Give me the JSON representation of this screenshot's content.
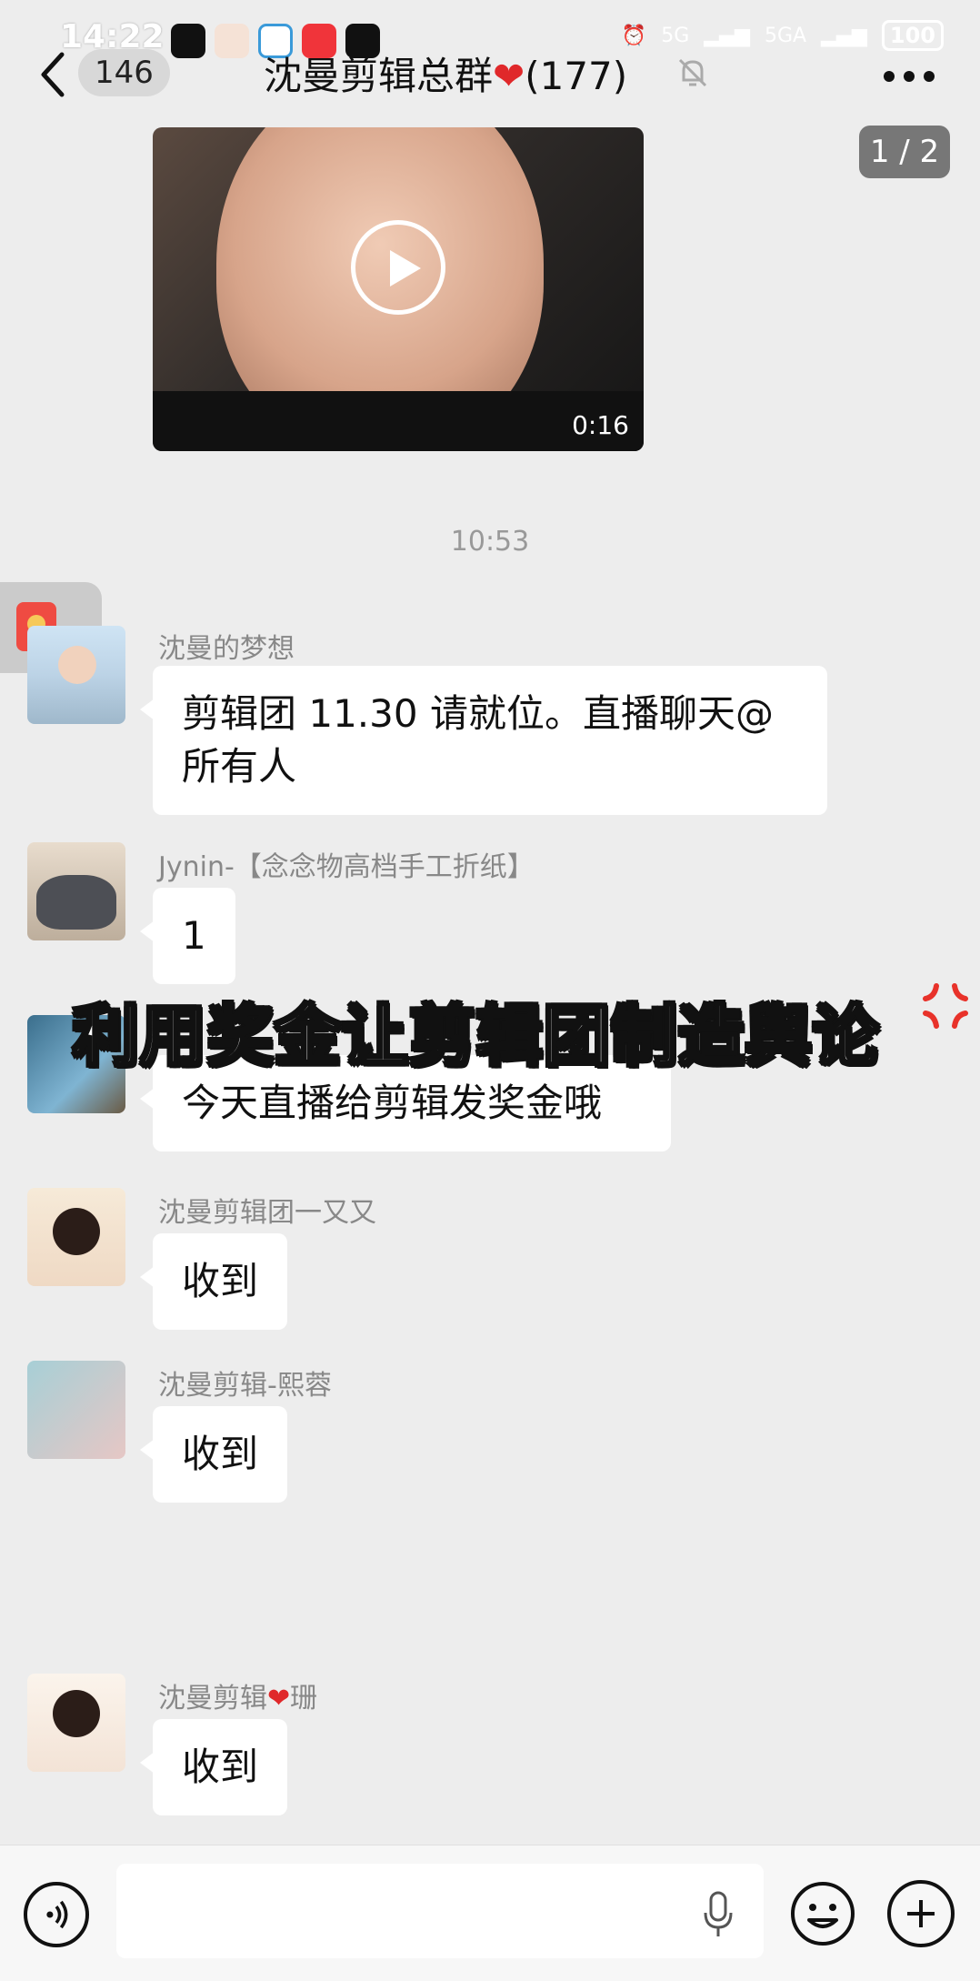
{
  "status_bar": {
    "time": "14:22",
    "network_1": "5G",
    "network_2": "5GA",
    "battery": "100"
  },
  "header": {
    "back_count": "146",
    "title": "沈曼剪辑总群",
    "member_count": "(177)"
  },
  "page_indicator": "1 / 2",
  "video": {
    "duration": "0:16"
  },
  "time_divider": "10:53",
  "messages": [
    {
      "sender": "沈曼的梦想",
      "text_line1": "剪辑团 11.30 请就位。直播聊天@",
      "text_line2": "所有人"
    },
    {
      "sender": "Jynin-【念念物高档手工折纸】",
      "text": "1"
    },
    {
      "text": "今天直播给剪辑发奖金哦"
    },
    {
      "sender": "沈曼剪辑团一又又",
      "text": "收到"
    },
    {
      "sender": "沈曼剪辑-熙蓉",
      "text": "收到"
    },
    {
      "sender_prefix": "沈曼剪辑",
      "sender_suffix": "珊",
      "text": "收到"
    }
  ],
  "overlay_caption": "利用奖金让剪辑团制造舆论",
  "icons": {
    "back": "chevron-left-icon",
    "mute": "bell-off-icon",
    "more": "more-icon",
    "play": "play-icon",
    "voice": "voice-icon",
    "mic": "mic-icon",
    "emoji": "emoji-icon",
    "plus": "plus-icon"
  },
  "colors": {
    "heart": "#e0282a",
    "background": "#ededed",
    "bubble": "#ffffff"
  }
}
